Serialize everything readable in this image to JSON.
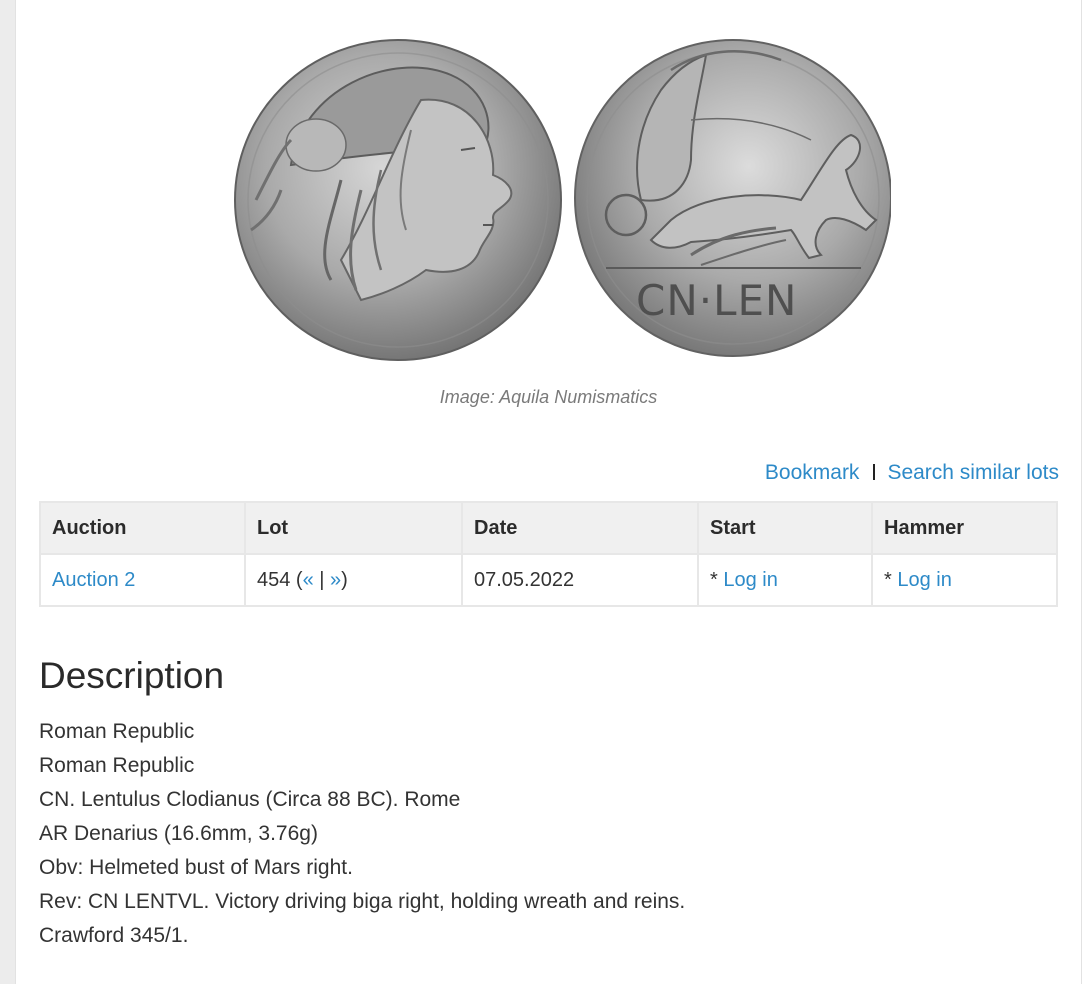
{
  "image": {
    "caption": "Image: Aquila Numismatics",
    "obverse_icon": "coin-obverse-mars-bust",
    "reverse_icon": "coin-reverse-victory-biga",
    "reverse_legend": "CN·LEN"
  },
  "actions": {
    "bookmark": "Bookmark",
    "search_similar": "Search similar lots"
  },
  "table": {
    "headers": [
      "Auction",
      "Lot",
      "Date",
      "Start",
      "Hammer"
    ],
    "row": {
      "auction": "Auction 2",
      "lot_number": "454",
      "lot_open": " (",
      "prev": "«",
      "nav_sep": " | ",
      "next": "»",
      "lot_close": ")",
      "date": "07.05.2022",
      "start_prefix": "* ",
      "start_link": "Log in",
      "hammer_prefix": "* ",
      "hammer_link": "Log in"
    }
  },
  "description": {
    "title": "Description",
    "lines": [
      "Roman Republic",
      "Roman Republic",
      "CN. Lentulus Clodianus (Circa 88 BC). Rome",
      "AR Denarius (16.6mm, 3.76g)",
      "Obv: Helmeted bust of Mars right.",
      "Rev: CN LENTVL. Victory driving biga right, holding wreath and reins.",
      "Crawford 345/1."
    ]
  },
  "colors": {
    "link": "#2d8ac8",
    "header_bg": "#f0f0f0",
    "page_bg": "#ffffff",
    "outer_bg": "#ececec"
  }
}
